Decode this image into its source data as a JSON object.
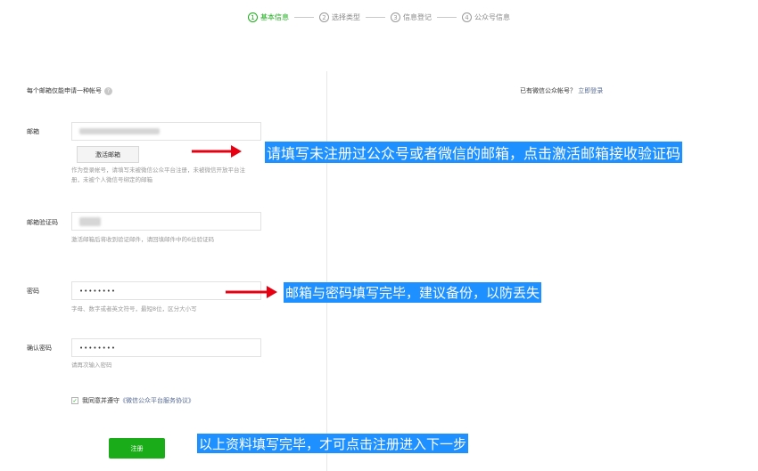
{
  "steps": [
    {
      "num": "1",
      "label": "基本信息"
    },
    {
      "num": "2",
      "label": "选择类型"
    },
    {
      "num": "3",
      "label": "信息登记"
    },
    {
      "num": "4",
      "label": "公众号信息"
    }
  ],
  "form": {
    "notice": "每个邮箱仅能申请一种帐号",
    "email_label": "邮箱",
    "activate_button": "激活邮箱",
    "email_hint": "作为登录帐号，请填写未被微信公众平台注册，未被微信开放平台注册，未被个人微信号绑定的邮箱",
    "code_label": "邮箱验证码",
    "code_hint": "激活邮箱后将收到验证邮件，请回填邮件中的6位验证码",
    "password_label": "密码",
    "password_value": "••••••••",
    "password_hint": "字母、数字或者英文符号，最短8位，区分大小写",
    "confirm_label": "确认密码",
    "confirm_value": "••••••••",
    "confirm_hint": "请再次输入密码",
    "agree_prefix": "我同意并遵守",
    "agree_link": "《微信公众平台服务协议》",
    "register_button": "注册"
  },
  "login_hint": {
    "text": "已有微信公众帐号？",
    "link": "立即登录"
  },
  "annotations": {
    "email": "请填写未注册过公众号或者微信的邮箱，点击激活邮箱接收验证码",
    "password": "邮箱与密码填写完毕，建议备份，以防丢失",
    "register": "以上资料填写完毕，才可点击注册进入下一步"
  },
  "colors": {
    "brand_green": "#1aad19",
    "annotation_blue": "#1e90ff",
    "arrow_red": "#e60012",
    "link_blue": "#576b95"
  }
}
